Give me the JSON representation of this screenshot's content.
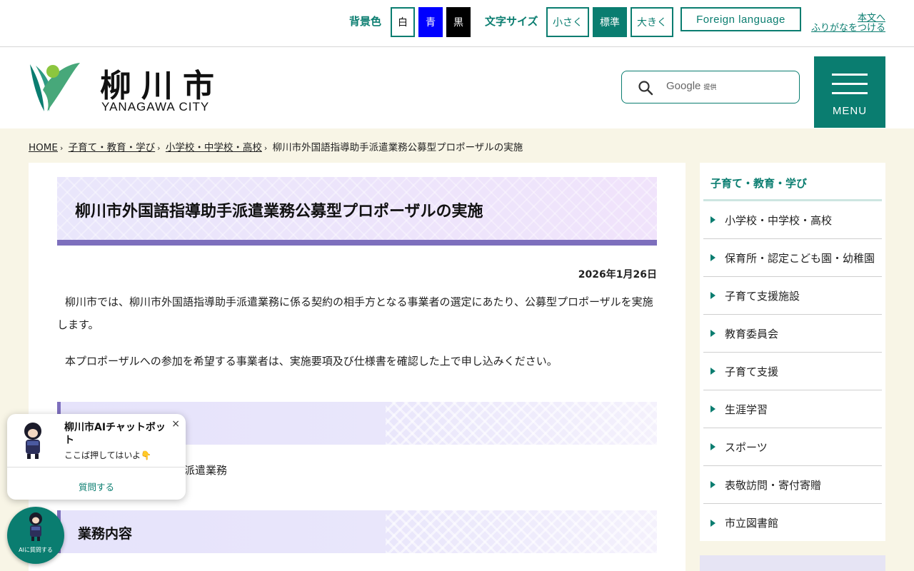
{
  "utility": {
    "bg_label": "背景色",
    "bg_white": "白",
    "bg_blue": "青",
    "bg_black": "黒",
    "font_label": "文字サイズ",
    "font_small": "小さく",
    "font_standard": "標準",
    "font_large": "大きく",
    "foreign": "Foreign language",
    "skip_link": "本文へ",
    "furigana_link": "ふりがなをつける"
  },
  "header": {
    "logo_kanji": "柳川市",
    "logo_english": "YANAGAWA CITY",
    "search_brand": "Google",
    "search_brand_small": "提供",
    "menu_label": "MENU"
  },
  "breadcrumb": {
    "home": "HOME",
    "level1": "子育て・教育・学び",
    "level2": "小学校・中学校・高校",
    "current": "柳川市外国語指導助手派遣業務公募型プロポーザルの実施"
  },
  "main": {
    "title": "柳川市外国語指導助手派遣業務公募型プロポーザルの実施",
    "date": "2026年1月26日",
    "para1": "柳川市では、柳川市外国語指導助手派遣業務に係る契約の相手方となる事業者の選定にあたり、公募型プロポーザルを実施します。",
    "para2": "本プロポーザルへの参加を希望する事業者は、実施要項及び仕様書を確認した上で申し込みください。",
    "section1_partial": "派遣業務",
    "section2_title": "業務内容"
  },
  "sidebar": {
    "title": "子育て・教育・学び",
    "items": [
      {
        "label": "小学校・中学校・高校"
      },
      {
        "label": "保育所・認定こども園・幼稚園"
      },
      {
        "label": "子育て支援施設"
      },
      {
        "label": "教育委員会"
      },
      {
        "label": "子育て支援"
      },
      {
        "label": "生涯学習"
      },
      {
        "label": "スポーツ"
      },
      {
        "label": "表敬訪問・寄付寄贈"
      },
      {
        "label": "市立図書館"
      }
    ]
  },
  "chatbot": {
    "title": "柳川市AIチャットボット",
    "close": "×",
    "subtitle": "ここば押してはいよ👇",
    "ask": "質問する",
    "fab_label": "AIに質問する"
  },
  "colors": {
    "accent": "#0a7d70",
    "title_band": "#7d6fbd",
    "page_bg": "#f8f5e6",
    "bg_blue_button": "#0000ff",
    "bg_black_button": "#000000"
  }
}
